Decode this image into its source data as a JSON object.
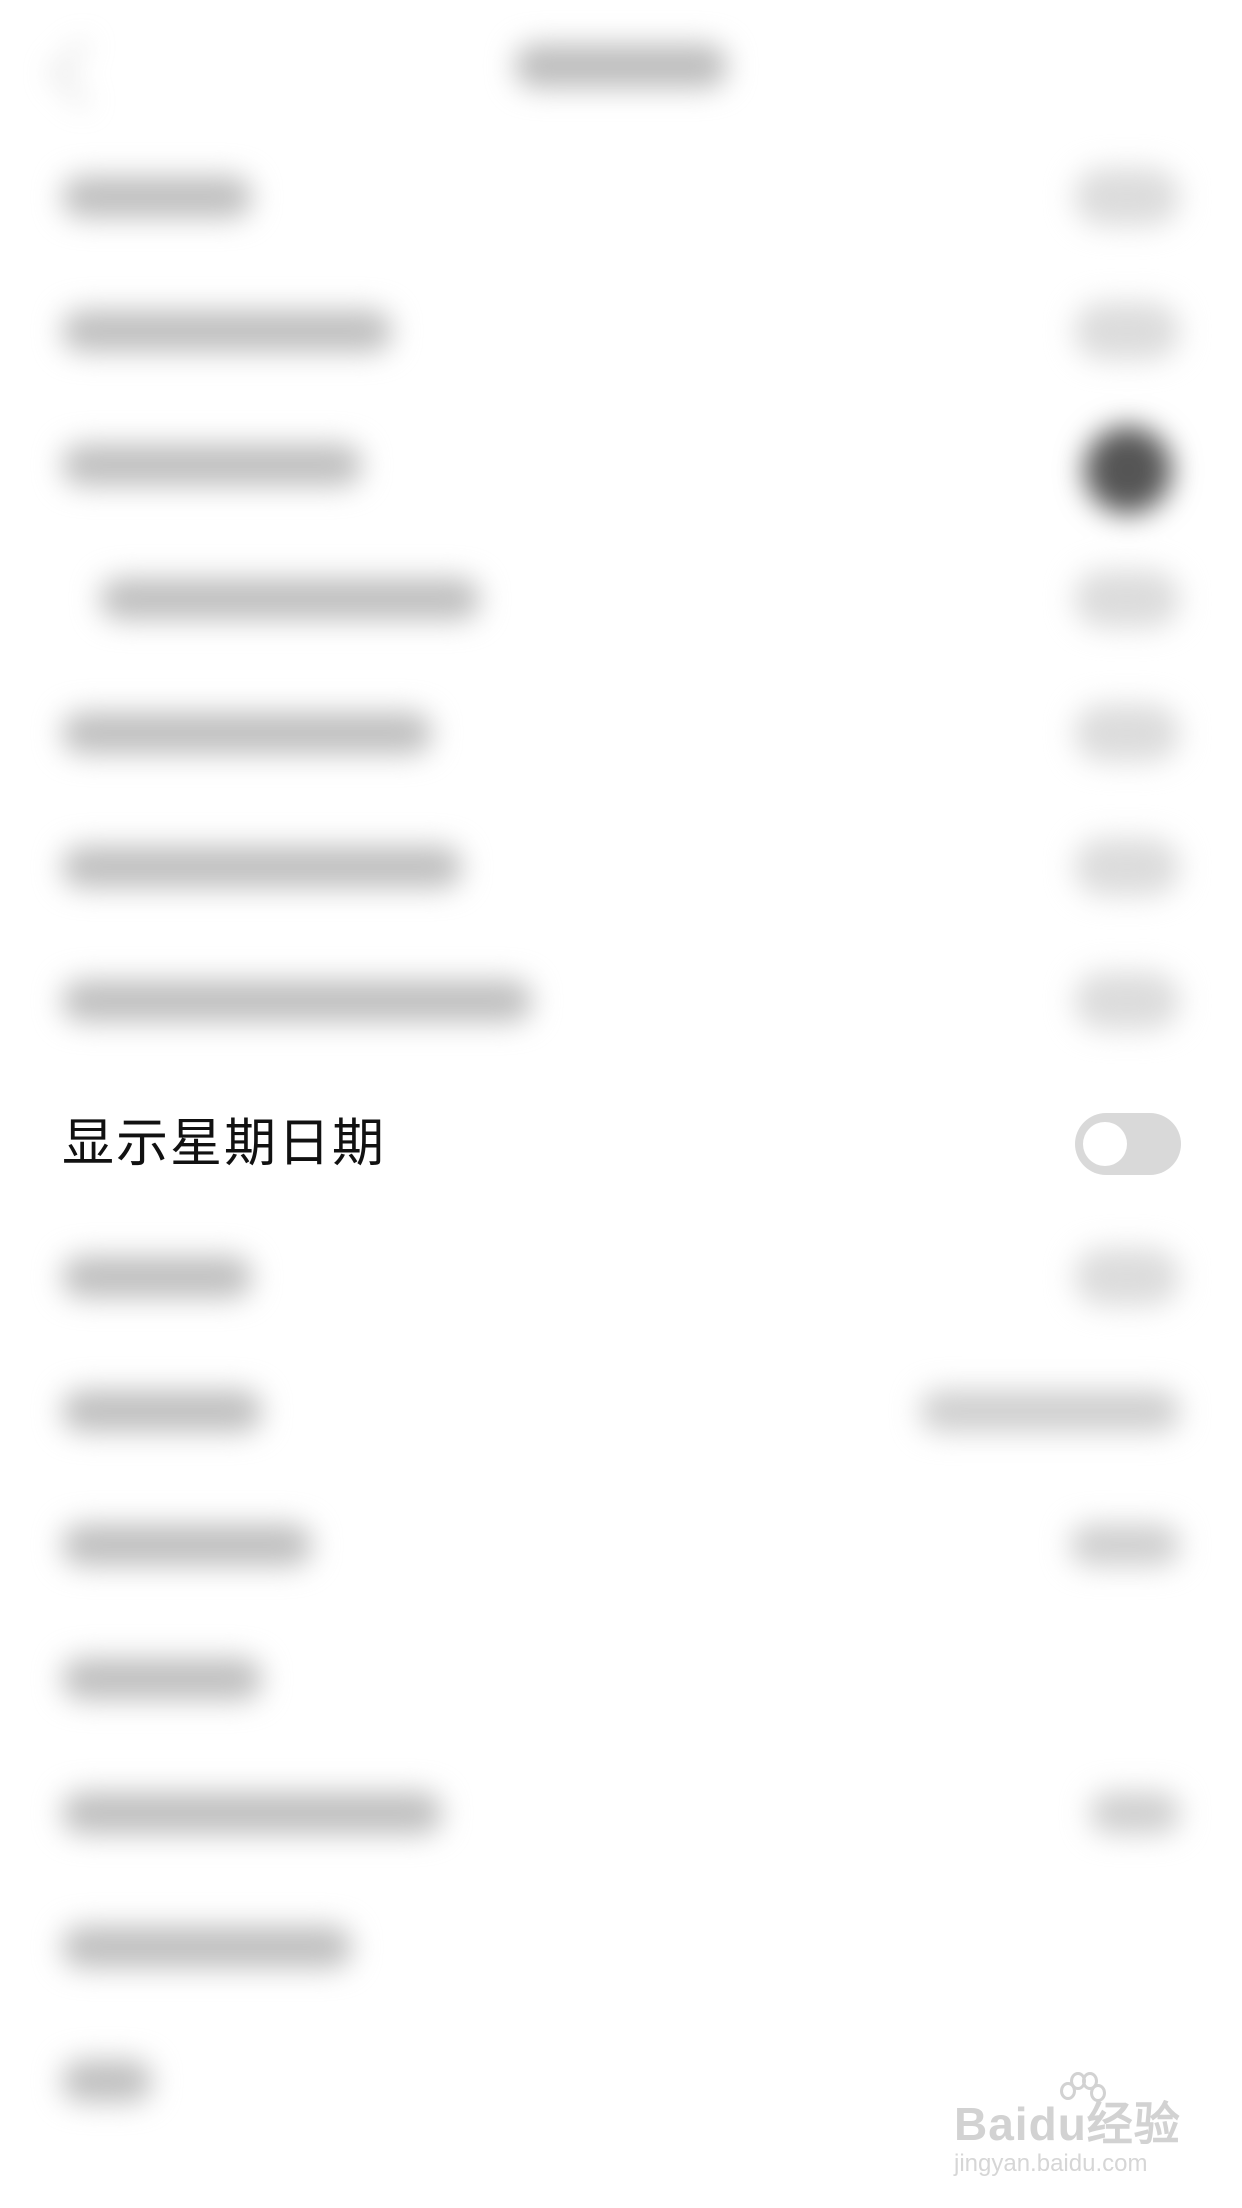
{
  "focused_setting": {
    "label": "显示星期日期",
    "toggle_on": false
  },
  "watermark": {
    "brand_latin": "Bai",
    "brand_latin_end": "du",
    "brand_cn": "经验",
    "site": "jingyan.baidu.com"
  },
  "colors": {
    "toggle_off_track": "#d9d9d9",
    "toggle_knob": "#ffffff",
    "text_primary": "#111111"
  }
}
